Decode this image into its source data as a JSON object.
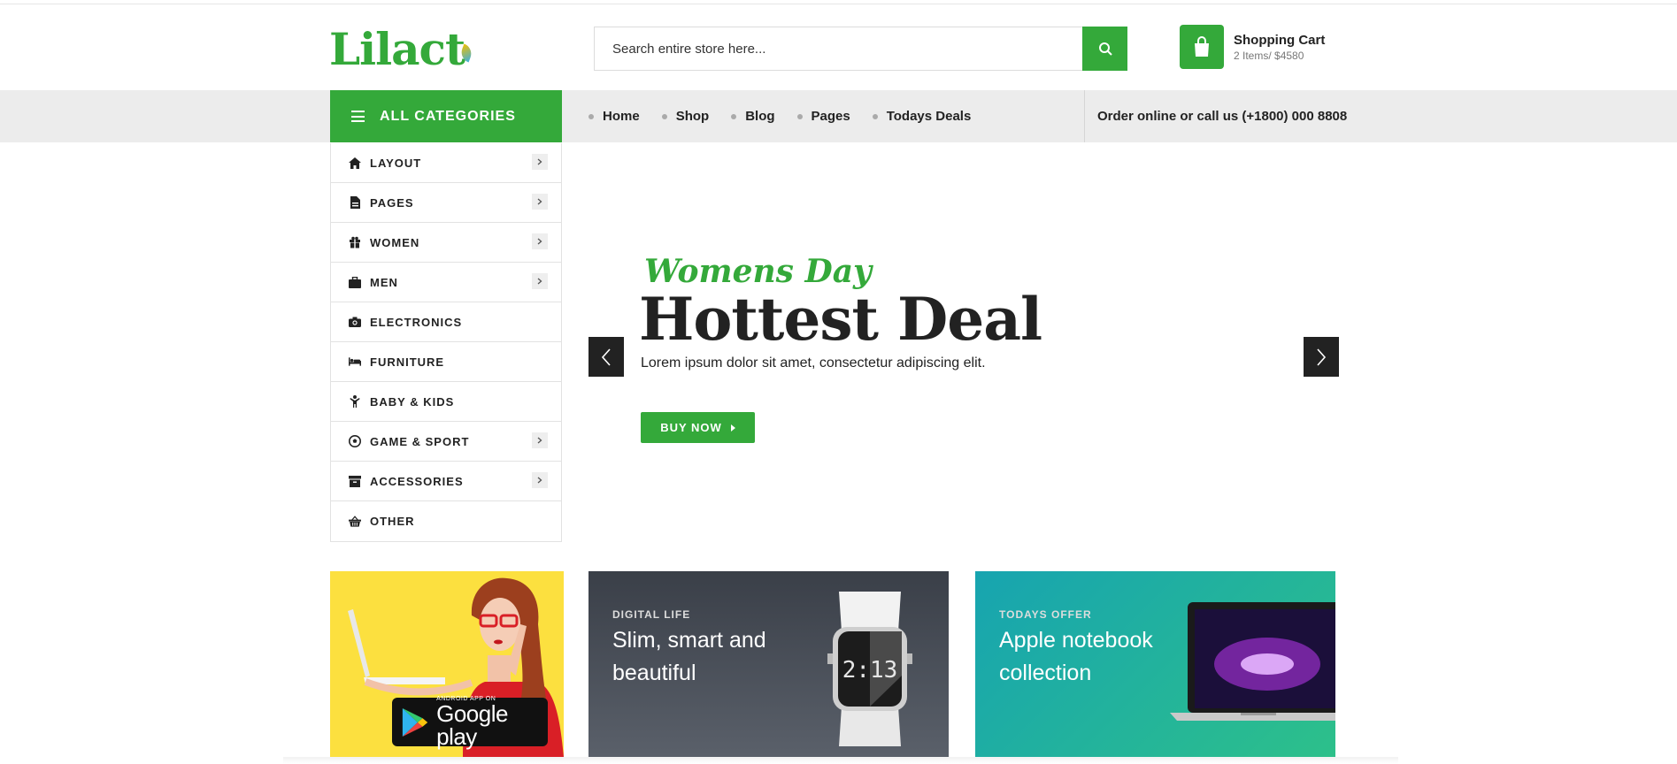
{
  "brand": {
    "logo_text": "Lilact"
  },
  "search": {
    "placeholder": "Search entire store here..."
  },
  "cart": {
    "title": "Shopping Cart",
    "summary": "2 Items/ $4580"
  },
  "nav": {
    "all_categories_label": "ALL CATEGORIES",
    "menu": [
      "Home",
      "Shop",
      "Blog",
      "Pages",
      "Todays Deals"
    ],
    "call_text": "Order online or call us (+1800) 000 8808"
  },
  "categories": [
    {
      "label": "LAYOUT",
      "icon": "home-icon",
      "has_sub": true
    },
    {
      "label": "PAGES",
      "icon": "file-icon",
      "has_sub": true
    },
    {
      "label": "WOMEN",
      "icon": "gift-icon",
      "has_sub": true
    },
    {
      "label": "MEN",
      "icon": "briefcase-icon",
      "has_sub": true
    },
    {
      "label": "ELECTRONICS",
      "icon": "camera-icon",
      "has_sub": false
    },
    {
      "label": "FURNITURE",
      "icon": "bed-icon",
      "has_sub": false
    },
    {
      "label": "BABY & KIDS",
      "icon": "child-icon",
      "has_sub": false
    },
    {
      "label": "GAME & SPORT",
      "icon": "soccer-ball-icon",
      "has_sub": true
    },
    {
      "label": "ACCESSORIES",
      "icon": "archive-icon",
      "has_sub": true
    },
    {
      "label": "OTHER",
      "icon": "basket-icon",
      "has_sub": false
    }
  ],
  "hero": {
    "script_title": "Womens Day",
    "title": "Hottest Deal",
    "subtitle": "Lorem ipsum dolor sit amet, consectetur adipiscing elit.",
    "button_label": "BUY NOW"
  },
  "banners": {
    "app": {
      "store_small": "ANDROID APP ON",
      "store_big": "Google play"
    },
    "digital": {
      "kicker": "DIGITAL LIFE",
      "headline": "Slim, smart and beautiful",
      "watch_time": "2:13"
    },
    "offer": {
      "kicker": "TODAYS OFFER",
      "headline": "Apple notebook collection"
    }
  },
  "colors": {
    "accent": "#34a93a",
    "dark": "#222222",
    "nav_bg": "#ececec"
  }
}
